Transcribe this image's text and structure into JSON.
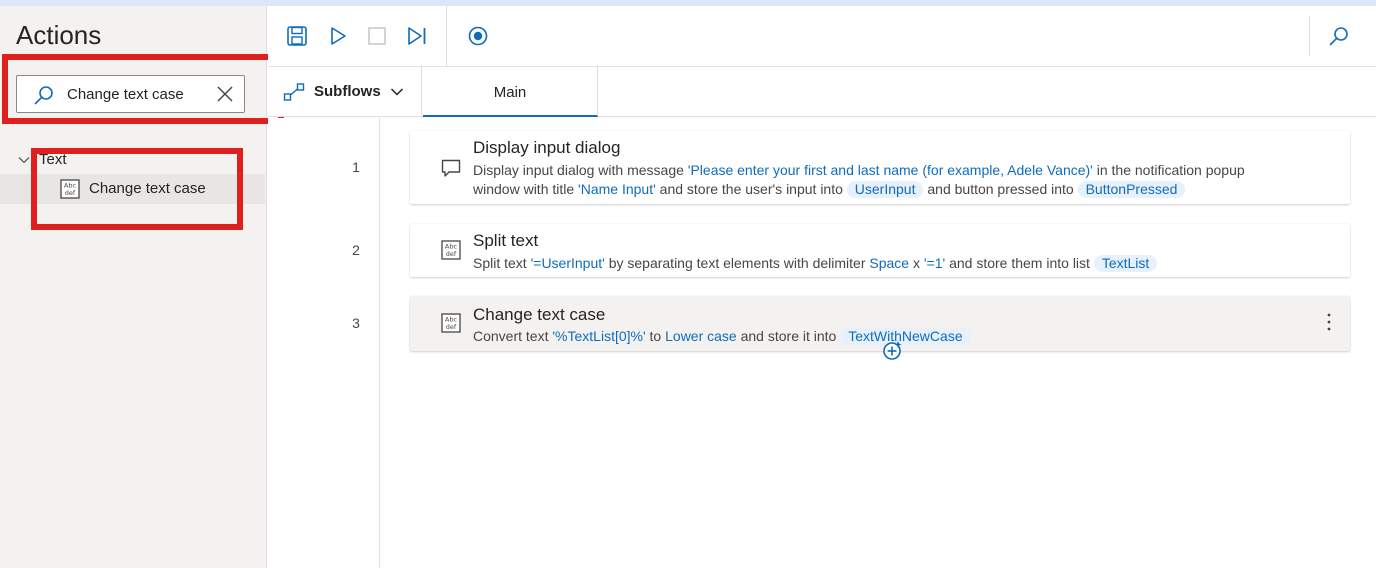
{
  "colors": {
    "accent": "#0f6cbd",
    "highlight": "#e01f1f",
    "panel": "#f3f2f1"
  },
  "sidebar": {
    "title": "Actions",
    "search": {
      "value": "Change text case",
      "icon": "search-icon",
      "clear_icon": "close-icon"
    },
    "group": {
      "label": "Text",
      "icon": "chevron-down-icon"
    },
    "item": {
      "label": "Change text case",
      "icon": "text-action-icon"
    }
  },
  "toolbar": {
    "buttons": [
      "save-icon",
      "run-icon",
      "stop-icon",
      "run-next-action-icon",
      "record-icon",
      "search-icon"
    ]
  },
  "tabs": {
    "subflows_label": "Subflows",
    "main_label": "Main"
  },
  "flow": {
    "actions": [
      {
        "line": "1",
        "title": "Display input dialog",
        "icon": "message-dialog-icon",
        "p1": "Display input dialog with message ",
        "p1_lit": "'Please enter your first and last name (for example, Adele Vance)'",
        "p1_tail": " in the notification popup",
        "p2": "window with title ",
        "p2_lit": "'Name Input'",
        "p2_mid": " and store the user's input into ",
        "var1": "UserInput",
        "p2_mid2": " and button pressed into ",
        "var2": "ButtonPressed"
      },
      {
        "line": "2",
        "title": "Split text",
        "icon": "text-action-icon",
        "p1": "Split text ",
        "lit1": "'=UserInput'",
        "p2": " by separating text elements with delimiter ",
        "lit2": "Space",
        "p3": " x ",
        "lit3": "'=1'",
        "p4": " and store them into list ",
        "var1": "TextList"
      },
      {
        "line": "3",
        "title": "Change text case",
        "icon": "text-action-icon",
        "p1": "Convert text ",
        "lit1": "'%TextList[0]%'",
        "p2": " to ",
        "lit2": "Lower case",
        "p3": " and store it into ",
        "var1": "TextWithNewCase"
      }
    ]
  }
}
